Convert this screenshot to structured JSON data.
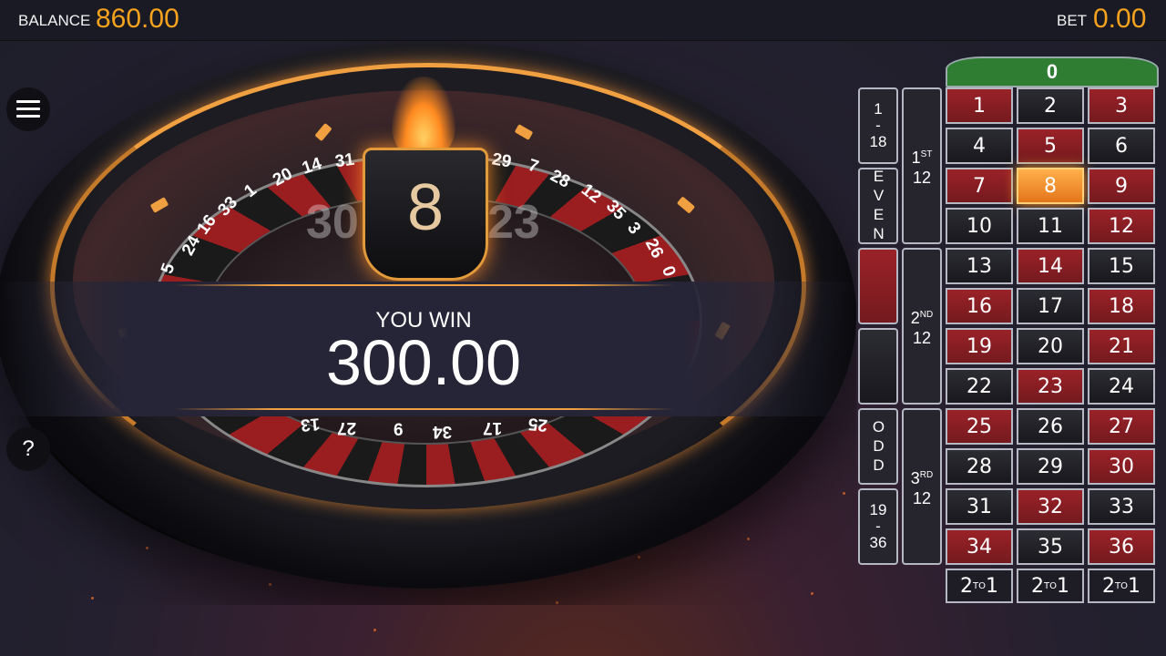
{
  "header": {
    "balance_label": "BALANCE",
    "balance_value": "860.00",
    "bet_label": "BET",
    "bet_value": "0.00",
    "accent_color": "#f5a21e"
  },
  "wheel": {
    "result_number": "8",
    "neighbor_left": "30",
    "neighbor_right": "23",
    "visible_numbers_left": [
      "5",
      "24",
      "16",
      "33",
      "1",
      "20",
      "14",
      "31"
    ],
    "visible_numbers_right": [
      "29",
      "7",
      "28",
      "12",
      "35",
      "3",
      "26",
      "0"
    ],
    "visible_numbers_bottom": [
      "13",
      "27",
      "6",
      "34",
      "17",
      "25"
    ]
  },
  "win": {
    "title": "YOU WIN",
    "amount": "300.00"
  },
  "controls": {
    "menu_icon": "hamburger-icon",
    "help_label": "?"
  },
  "table": {
    "zero": "0",
    "rows": [
      [
        {
          "n": "1",
          "c": "red"
        },
        {
          "n": "2",
          "c": "black"
        },
        {
          "n": "3",
          "c": "red"
        }
      ],
      [
        {
          "n": "4",
          "c": "black"
        },
        {
          "n": "5",
          "c": "red"
        },
        {
          "n": "6",
          "c": "black"
        }
      ],
      [
        {
          "n": "7",
          "c": "red"
        },
        {
          "n": "8",
          "c": "hit"
        },
        {
          "n": "9",
          "c": "red"
        }
      ],
      [
        {
          "n": "10",
          "c": "black"
        },
        {
          "n": "11",
          "c": "black"
        },
        {
          "n": "12",
          "c": "red"
        }
      ],
      [
        {
          "n": "13",
          "c": "black"
        },
        {
          "n": "14",
          "c": "red"
        },
        {
          "n": "15",
          "c": "black"
        }
      ],
      [
        {
          "n": "16",
          "c": "red"
        },
        {
          "n": "17",
          "c": "black"
        },
        {
          "n": "18",
          "c": "red"
        }
      ],
      [
        {
          "n": "19",
          "c": "red"
        },
        {
          "n": "20",
          "c": "black"
        },
        {
          "n": "21",
          "c": "red"
        }
      ],
      [
        {
          "n": "22",
          "c": "black"
        },
        {
          "n": "23",
          "c": "red"
        },
        {
          "n": "24",
          "c": "black"
        }
      ],
      [
        {
          "n": "25",
          "c": "red"
        },
        {
          "n": "26",
          "c": "black"
        },
        {
          "n": "27",
          "c": "red"
        }
      ],
      [
        {
          "n": "28",
          "c": "black"
        },
        {
          "n": "29",
          "c": "black"
        },
        {
          "n": "30",
          "c": "red"
        }
      ],
      [
        {
          "n": "31",
          "c": "black"
        },
        {
          "n": "32",
          "c": "red"
        },
        {
          "n": "33",
          "c": "black"
        }
      ],
      [
        {
          "n": "34",
          "c": "red"
        },
        {
          "n": "35",
          "c": "black"
        },
        {
          "n": "36",
          "c": "red"
        }
      ]
    ],
    "low_label_top": "1",
    "low_label_dash": "-",
    "low_label_bottom": "18",
    "even_label": "EVEN",
    "odd_label": "ODD",
    "high_label_top": "19",
    "high_label_dash": "-",
    "high_label_bottom": "36",
    "red_color": "#9a2228",
    "black_color": "#2c2c33",
    "dozens": [
      {
        "num": "1",
        "suffix": "ST",
        "value": "12"
      },
      {
        "num": "2",
        "suffix": "ND",
        "value": "12"
      },
      {
        "num": "3",
        "suffix": "RD",
        "value": "12"
      }
    ],
    "column_bet": {
      "left": "2",
      "sup": "TO",
      "right": "1"
    }
  }
}
